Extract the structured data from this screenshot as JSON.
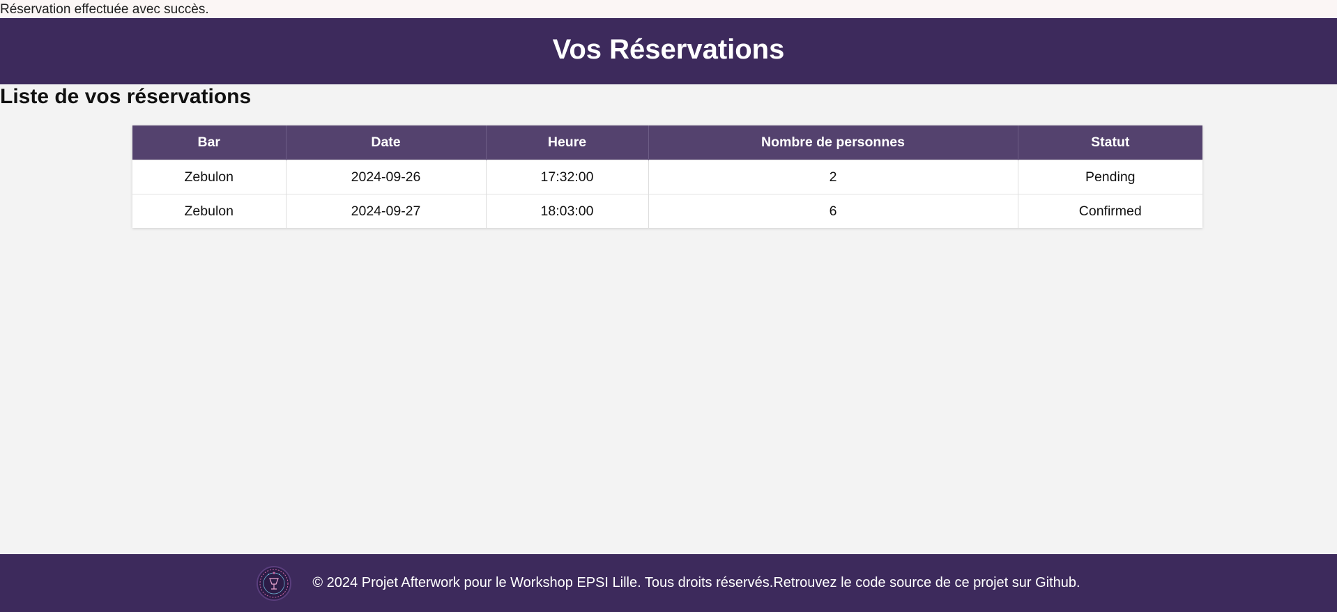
{
  "flash_message": "Réservation effectuée avec succès.",
  "header": {
    "title": "Vos Réservations"
  },
  "main": {
    "section_title": "Liste de vos réservations"
  },
  "table": {
    "headers": [
      "Bar",
      "Date",
      "Heure",
      "Nombre de personnes",
      "Statut"
    ],
    "rows": [
      [
        "Zebulon",
        "2024-09-26",
        "17:32:00",
        "2",
        "Pending"
      ],
      [
        "Zebulon",
        "2024-09-27",
        "18:03:00",
        "6",
        "Confirmed"
      ]
    ]
  },
  "footer": {
    "text": "© 2024 Projet Afterwork pour le Workshop EPSI Lille. Tous droits réservés.Retrouvez le code source de ce projet sur Github.",
    "logo_icon": "afterwork-logo-icon"
  },
  "colors": {
    "header_bg": "#3d2a5c",
    "table_header_bg": "#54426e",
    "page_bg": "#f3f3f3"
  }
}
